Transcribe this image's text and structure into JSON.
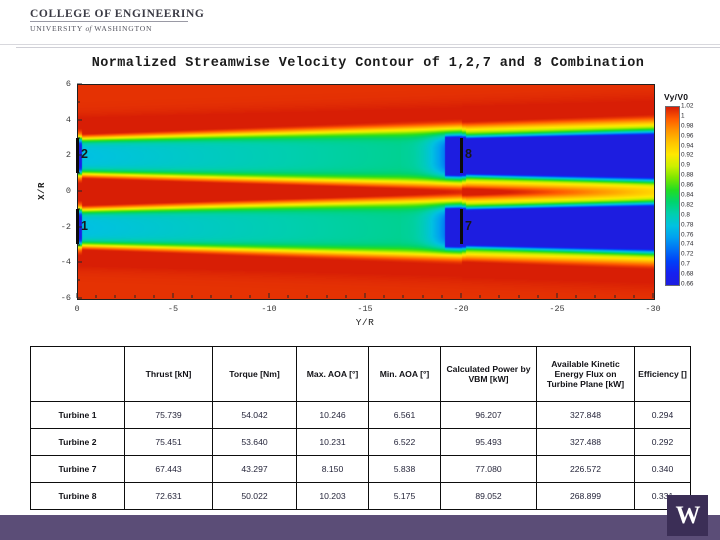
{
  "branding": {
    "line1": "COLLEGE OF ENGINEERING",
    "line2_pre": "UNIVERSITY",
    "line2_it": "of",
    "line2_post": "WASHINGTON",
    "logo_letter": "W",
    "footer_color": "#5b4d77",
    "logo_color": "#3b2e56"
  },
  "chart_data": {
    "type": "heatmap",
    "title": "Normalized Streamwise Velocity Contour of 1,2,7 and 8 Combination",
    "xlabel": "Y/R",
    "ylabel": "X/R",
    "grid": false,
    "xlim": [
      0,
      -30
    ],
    "ylim": [
      -6,
      6
    ],
    "xticks": [
      "0",
      "-5",
      "-10",
      "-15",
      "-20",
      "-25",
      "-30"
    ],
    "xtick_values": [
      0,
      -5,
      -10,
      -15,
      -20,
      -25,
      -30
    ],
    "yticks": [
      "6",
      "4",
      "2",
      "0",
      "-2",
      "-4",
      "-6"
    ],
    "ytick_values": [
      6,
      4,
      2,
      0,
      -2,
      -4,
      -6
    ],
    "colorbar": {
      "label": "Vy/V0",
      "position": "right",
      "vmin": 0.66,
      "vmax": 1.02,
      "ticks": [
        "1.02",
        "1",
        "0.98",
        "0.96",
        "0.94",
        "0.92",
        "0.9",
        "0.88",
        "0.86",
        "0.84",
        "0.82",
        "0.8",
        "0.78",
        "0.76",
        "0.74",
        "0.72",
        "0.7",
        "0.68",
        "0.66"
      ],
      "tick_values": [
        1.02,
        1,
        0.98,
        0.96,
        0.94,
        0.92,
        0.9,
        0.88,
        0.86,
        0.84,
        0.82,
        0.8,
        0.78,
        0.76,
        0.74,
        0.72,
        0.7,
        0.68,
        0.66
      ],
      "colors": [
        "#d81e05",
        "#ff5a00",
        "#ff9500",
        "#ffc400",
        "#ffe800",
        "#ccf000",
        "#7ae600",
        "#22dd22",
        "#00d46e",
        "#00cfae",
        "#00c2e0",
        "#00a0f0",
        "#0070f5",
        "#0040f8",
        "#1520f0",
        "#1d1de0"
      ]
    },
    "annotations": [
      {
        "label": "2",
        "x": 0,
        "y": 2,
        "type": "turbine",
        "span_y": [
          1,
          3
        ]
      },
      {
        "label": "1",
        "x": 0,
        "y": -2,
        "type": "turbine",
        "span_y": [
          -1,
          -3
        ]
      },
      {
        "label": "8",
        "x": -20,
        "y": 2,
        "type": "turbine",
        "span_y": [
          1,
          3
        ]
      },
      {
        "label": "7",
        "x": -20,
        "y": -2,
        "type": "turbine",
        "span_y": [
          -1,
          -3
        ]
      }
    ]
  },
  "table": {
    "columns": [
      "",
      "Thrust [kN]",
      "Torque [Nm]",
      "Max. AOA [°]",
      "Min. AOA [°]",
      "Calculated Power by VBM [kW]",
      "Available Kinetic Energy Flux on Turbine Plane [kW]",
      "Efficiency []"
    ],
    "rows": [
      [
        "Turbine 1",
        "75.739",
        "54.042",
        "10.246",
        "6.561",
        "96.207",
        "327.848",
        "0.294"
      ],
      [
        "Turbine 2",
        "75.451",
        "53.640",
        "10.231",
        "6.522",
        "95.493",
        "327.488",
        "0.292"
      ],
      [
        "Turbine 7",
        "67.443",
        "43.297",
        "8.150",
        "5.838",
        "77.080",
        "226.572",
        "0.340"
      ],
      [
        "Turbine 8",
        "72.631",
        "50.022",
        "10.203",
        "5.175",
        "89.052",
        "268.899",
        "0.331"
      ]
    ]
  }
}
